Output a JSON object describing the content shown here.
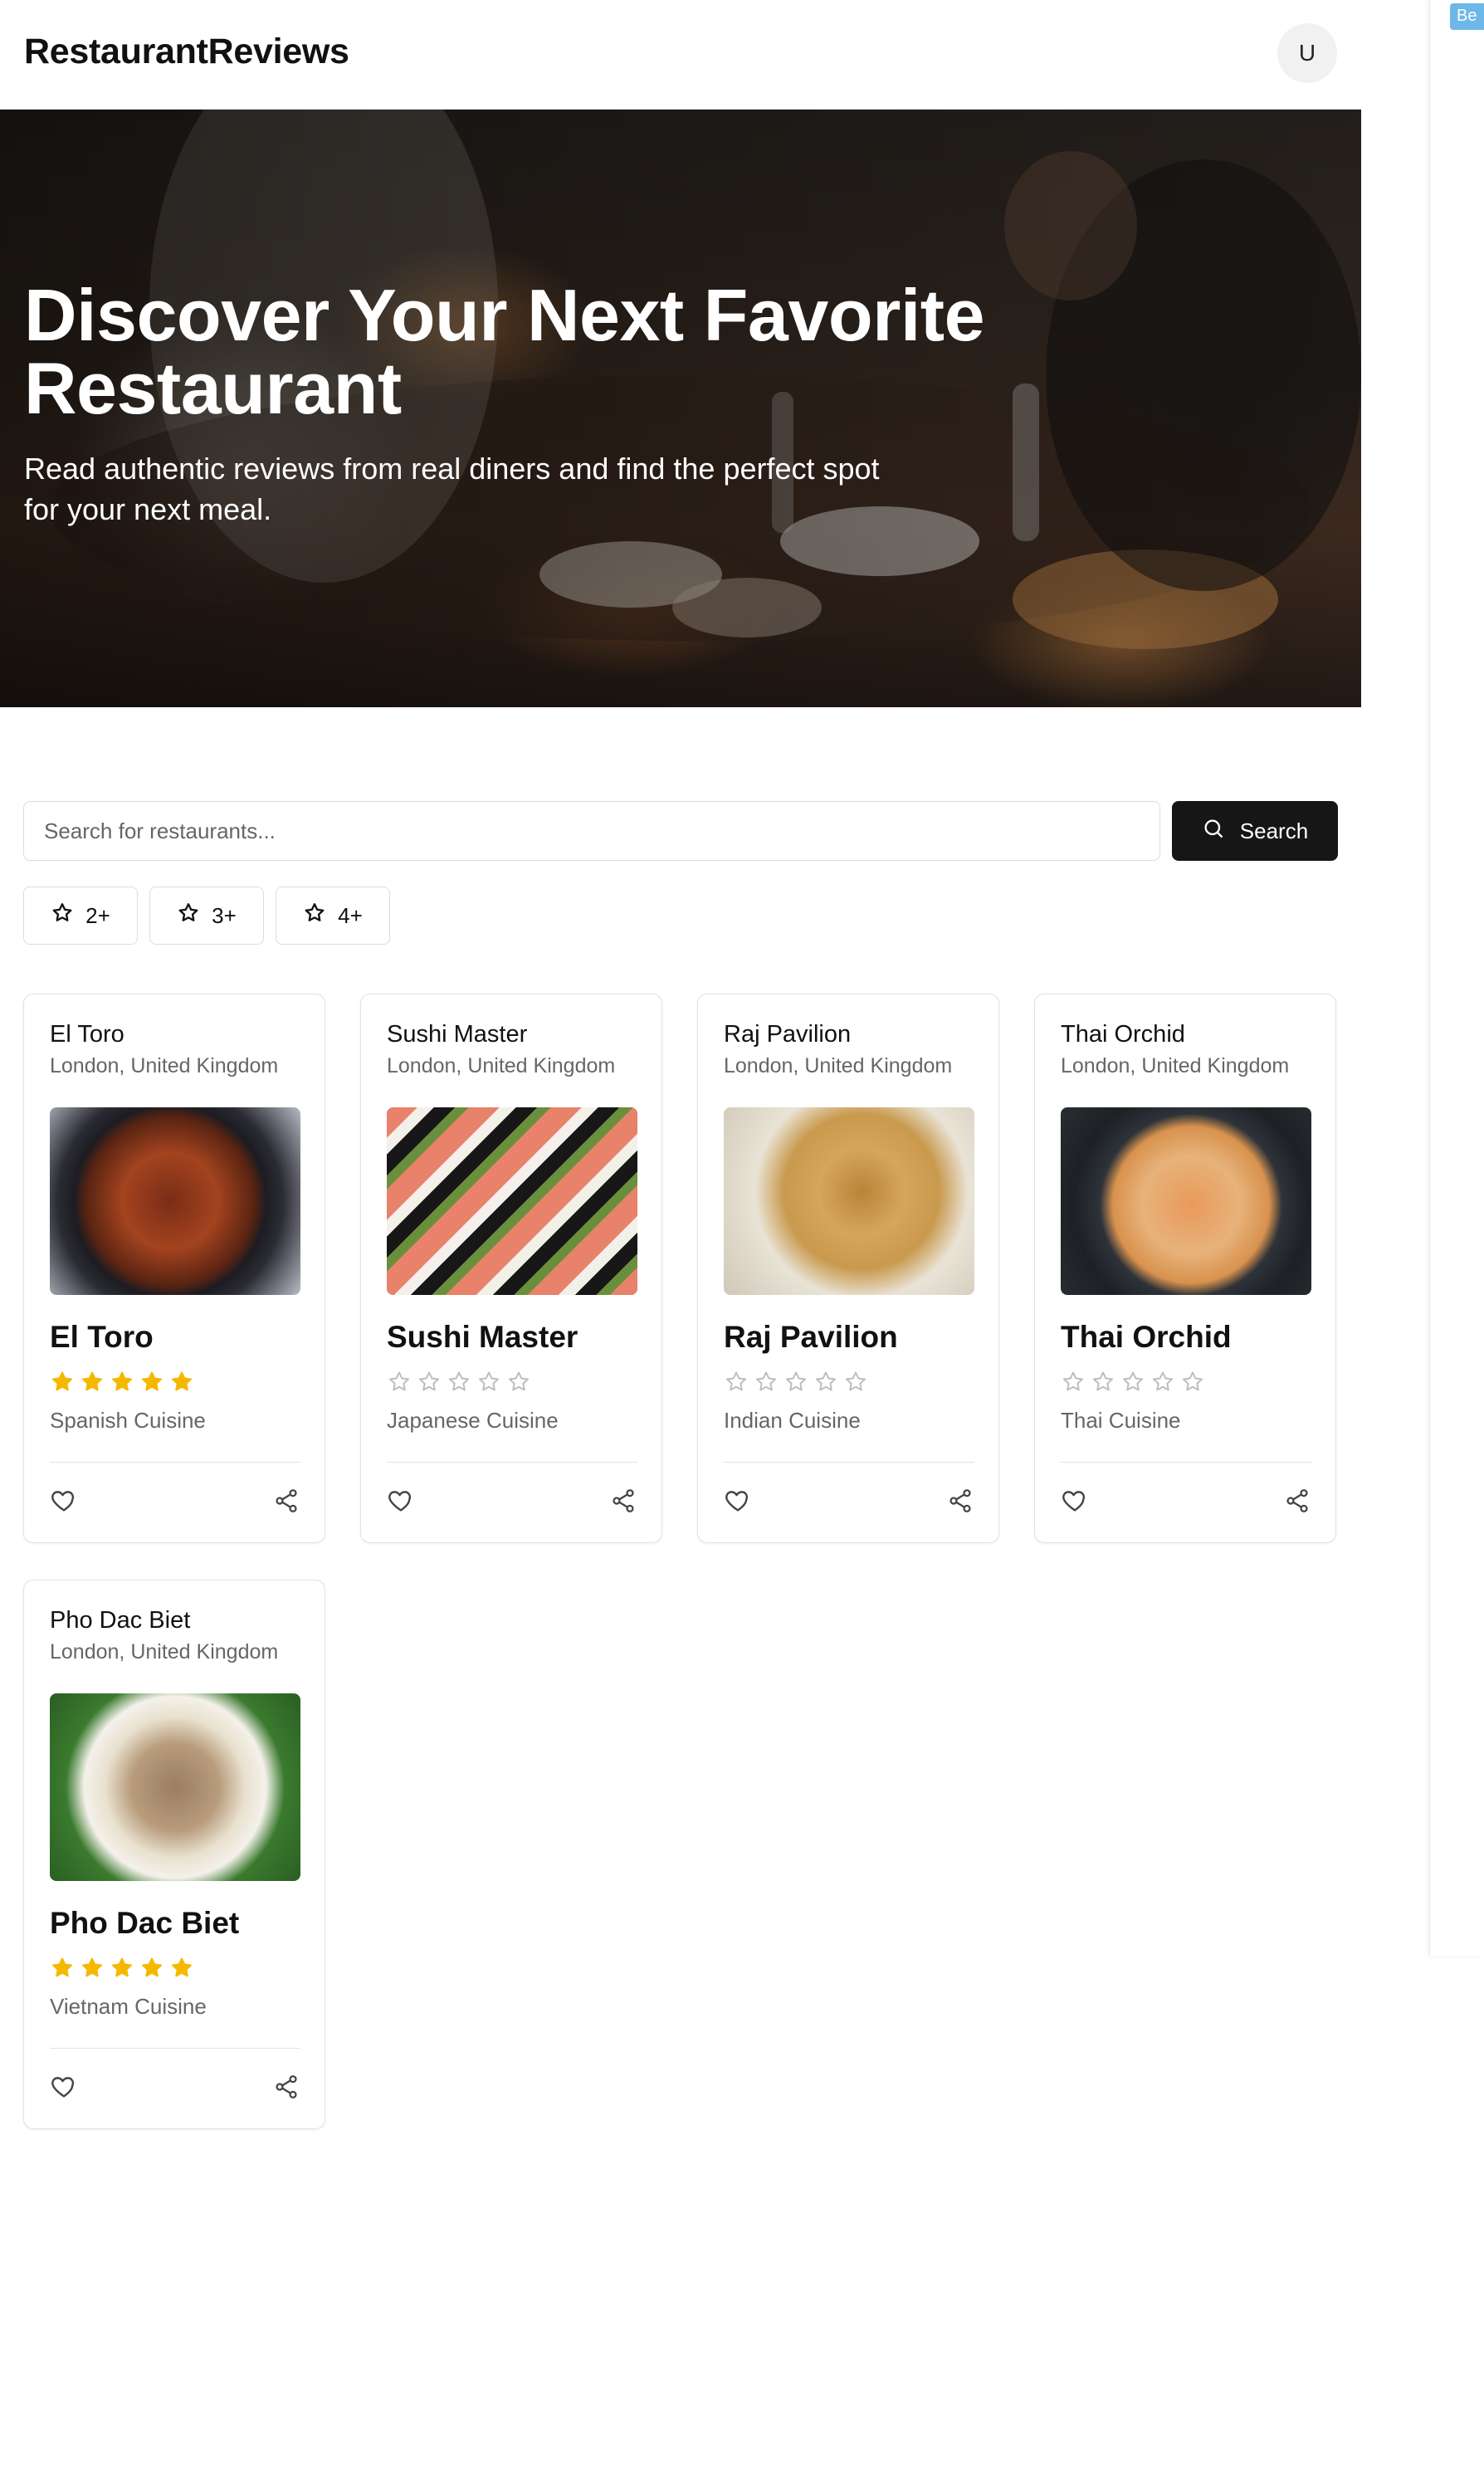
{
  "header": {
    "brand": "RestaurantReviews",
    "avatar_initial": "U"
  },
  "hero": {
    "title": "Discover Your Next Favorite Restaurant",
    "subtitle": "Read authentic reviews from real diners and find the perfect spot for your next meal."
  },
  "search": {
    "placeholder": "Search for restaurants...",
    "button_label": "Search"
  },
  "filters": [
    {
      "label": "2+",
      "icon": "star-outline-icon"
    },
    {
      "label": "3+",
      "icon": "star-outline-icon"
    },
    {
      "label": "4+",
      "icon": "star-outline-icon"
    }
  ],
  "restaurants": [
    {
      "name": "El Toro",
      "location": "London, United Kingdom",
      "cuisine": "Spanish Cuisine",
      "rating": 5,
      "image": "paella"
    },
    {
      "name": "Sushi Master",
      "location": "London, United Kingdom",
      "cuisine": "Japanese Cuisine",
      "rating": 0,
      "image": "sushi"
    },
    {
      "name": "Raj Pavilion",
      "location": "London, United Kingdom",
      "cuisine": "Indian Cuisine",
      "rating": 0,
      "image": "biryani"
    },
    {
      "name": "Thai Orchid",
      "location": "London, United Kingdom",
      "cuisine": "Thai Cuisine",
      "rating": 0,
      "image": "thai-curry"
    },
    {
      "name": "Pho Dac Biet",
      "location": "London, United Kingdom",
      "cuisine": "Vietnam Cuisine",
      "rating": 5,
      "image": "pho"
    }
  ],
  "side_panel": {
    "badge_text": "Be"
  },
  "colors": {
    "star_filled": "#f5b800",
    "star_empty": "#bdbdbd",
    "button_dark": "#161616",
    "badge_blue": "#6db8e8"
  }
}
